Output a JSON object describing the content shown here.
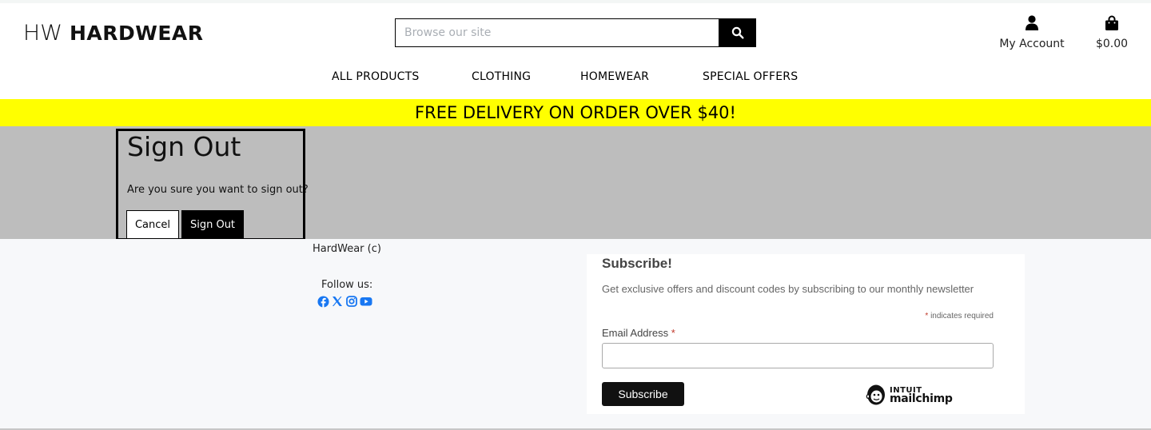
{
  "header": {
    "logo_prefix": "HW",
    "logo_brand": "HARDWEAR",
    "search_placeholder": "Browse our site",
    "account_label": "My Account",
    "cart_total": "$0.00"
  },
  "nav": {
    "items": [
      {
        "label": "ALL PRODUCTS"
      },
      {
        "label": "CLOTHING"
      },
      {
        "label": "HOMEWEAR"
      },
      {
        "label": "SPECIAL OFFERS"
      }
    ]
  },
  "banner": {
    "text": "FREE DELIVERY ON ORDER OVER $40!"
  },
  "signout": {
    "title": "Sign Out",
    "message": "Are you sure you want to sign out?",
    "cancel_label": "Cancel",
    "confirm_label": "Sign Out"
  },
  "footer": {
    "copyright": "HardWear (c)",
    "follow_label": "Follow us:",
    "socials": [
      "facebook-icon",
      "x-icon",
      "instagram-icon",
      "youtube-icon"
    ]
  },
  "subscribe": {
    "title": "Subscribe!",
    "description": "Get exclusive offers and discount codes by subscribing to our monthly newsletter",
    "required_star": "*",
    "required_note": "indicates required",
    "email_label": "Email Address",
    "email_value": "",
    "button_label": "Subscribe",
    "badge_line1": "INTUIT",
    "badge_line2": "mailchimp"
  },
  "colors": {
    "banner": "#ffff00",
    "band": "#bdbdbd",
    "social": "#1877f2",
    "required": "#c0392b"
  }
}
